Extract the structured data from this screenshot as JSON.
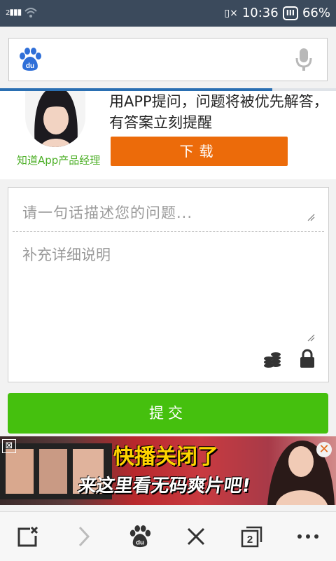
{
  "status_bar": {
    "sim": "2",
    "time": "10:36",
    "battery_percent": "66%",
    "battery_icon": "battery-icon",
    "vibrate_icon": "vibrate-icon"
  },
  "search": {
    "placeholder": "",
    "load_progress": 0.81
  },
  "promo": {
    "text": "用APP提问，问题将被优先解答，有答案立刻提醒",
    "manager_label": "知道App产品经理",
    "download_label": "下载"
  },
  "form": {
    "title_placeholder": "请一句话描述您的问题...",
    "detail_placeholder": "补充详细说明"
  },
  "submit_label": "提交",
  "ad": {
    "line1": "快播关闭了",
    "line2": "来这里看无码爽片吧!",
    "close_glyph": "✕",
    "x_glyph": "⊠"
  },
  "colors": {
    "status_bg": "#3b4a5c",
    "download_orange": "#ec6b0a",
    "submit_green": "#45c00e",
    "label_green": "#4caf26",
    "progress_blue": "#2a6fb2"
  },
  "bottom_nav": [
    "close-tab-icon",
    "forward-icon",
    "baidu-paw-icon",
    "stop-icon",
    "tabs-count-icon",
    "more-icon"
  ],
  "tabs_count": "2"
}
